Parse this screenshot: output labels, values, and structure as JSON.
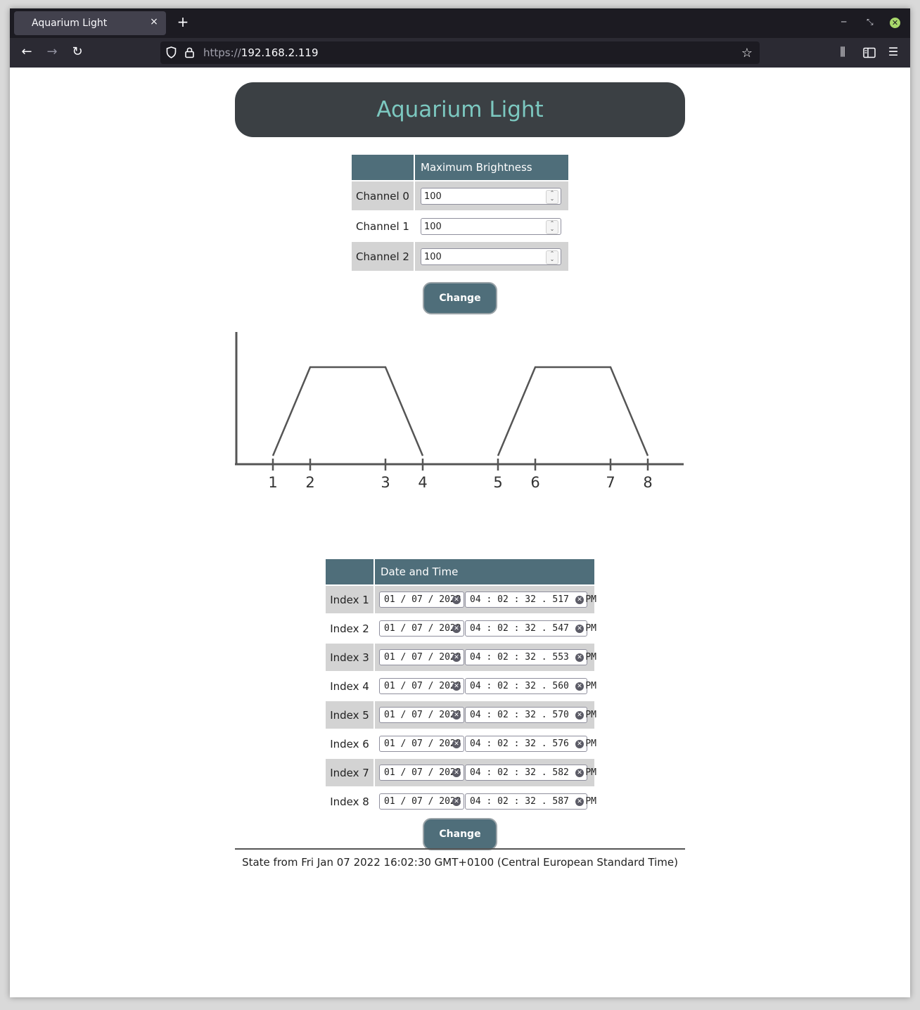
{
  "browser": {
    "tab_title": "Aquarium Light",
    "tab_close": "×",
    "new_tab": "+",
    "url_protocol": "https://",
    "url_host": "192.168.2.119"
  },
  "page": {
    "title": "Aquarium Light",
    "brightness_header": "Maximum Brightness",
    "channels": [
      {
        "label": "Channel 0",
        "value": "100"
      },
      {
        "label": "Channel 1",
        "value": "100"
      },
      {
        "label": "Channel 2",
        "value": "100"
      }
    ],
    "change_label": "Change",
    "datetime_header": "Date and Time",
    "indexes": [
      {
        "label": "Index 1",
        "date": "01 / 07 / 2022",
        "time": "04 : 02 : 32 . 517   PM"
      },
      {
        "label": "Index 2",
        "date": "01 / 07 / 2022",
        "time": "04 : 02 : 32 . 547   PM"
      },
      {
        "label": "Index 3",
        "date": "01 / 07 / 2022",
        "time": "04 : 02 : 32 . 553   PM"
      },
      {
        "label": "Index 4",
        "date": "01 / 07 / 2022",
        "time": "04 : 02 : 32 . 560   PM"
      },
      {
        "label": "Index 5",
        "date": "01 / 07 / 2022",
        "time": "04 : 02 : 32 . 570   PM"
      },
      {
        "label": "Index 6",
        "date": "01 / 07 / 2022",
        "time": "04 : 02 : 32 . 576   PM"
      },
      {
        "label": "Index 7",
        "date": "01 / 07 / 2022",
        "time": "04 : 02 : 32 . 582   PM"
      },
      {
        "label": "Index 8",
        "date": "01 / 07 / 2022",
        "time": "04 : 02 : 32 . 587   PM"
      }
    ],
    "state_text": "State from Fri Jan 07 2022 16:02:30 GMT+0100 (Central European Standard Time)"
  },
  "diagram": {
    "tick_labels": [
      "1",
      "2",
      "3",
      "4",
      "5",
      "6",
      "7",
      "8"
    ]
  },
  "colors": {
    "header_bg": "#3b4044",
    "title_color": "#7cc8c0",
    "table_header_bg": "#4f6e7a",
    "row_shade": "#d3d3d3"
  },
  "icons": {
    "back": "arrow-left-icon",
    "forward": "arrow-right-icon",
    "reload": "reload-icon",
    "shield": "shield-icon",
    "lock": "lock-icon",
    "bookmark": "star-icon",
    "library": "library-icon",
    "sidebar": "sidebar-icon",
    "menu": "hamburger-menu-icon"
  }
}
